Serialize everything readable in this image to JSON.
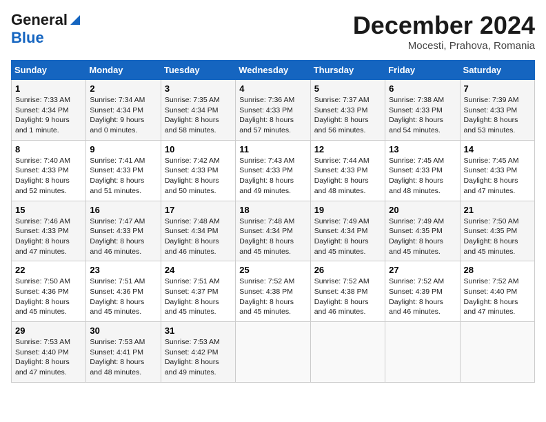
{
  "header": {
    "logo_line1": "General",
    "logo_line2": "Blue",
    "month": "December 2024",
    "location": "Mocesti, Prahova, Romania"
  },
  "weekdays": [
    "Sunday",
    "Monday",
    "Tuesday",
    "Wednesday",
    "Thursday",
    "Friday",
    "Saturday"
  ],
  "weeks": [
    [
      {
        "day": "1",
        "sunrise": "Sunrise: 7:33 AM",
        "sunset": "Sunset: 4:34 PM",
        "daylight": "Daylight: 9 hours and 1 minute."
      },
      {
        "day": "2",
        "sunrise": "Sunrise: 7:34 AM",
        "sunset": "Sunset: 4:34 PM",
        "daylight": "Daylight: 9 hours and 0 minutes."
      },
      {
        "day": "3",
        "sunrise": "Sunrise: 7:35 AM",
        "sunset": "Sunset: 4:34 PM",
        "daylight": "Daylight: 8 hours and 58 minutes."
      },
      {
        "day": "4",
        "sunrise": "Sunrise: 7:36 AM",
        "sunset": "Sunset: 4:33 PM",
        "daylight": "Daylight: 8 hours and 57 minutes."
      },
      {
        "day": "5",
        "sunrise": "Sunrise: 7:37 AM",
        "sunset": "Sunset: 4:33 PM",
        "daylight": "Daylight: 8 hours and 56 minutes."
      },
      {
        "day": "6",
        "sunrise": "Sunrise: 7:38 AM",
        "sunset": "Sunset: 4:33 PM",
        "daylight": "Daylight: 8 hours and 54 minutes."
      },
      {
        "day": "7",
        "sunrise": "Sunrise: 7:39 AM",
        "sunset": "Sunset: 4:33 PM",
        "daylight": "Daylight: 8 hours and 53 minutes."
      }
    ],
    [
      {
        "day": "8",
        "sunrise": "Sunrise: 7:40 AM",
        "sunset": "Sunset: 4:33 PM",
        "daylight": "Daylight: 8 hours and 52 minutes."
      },
      {
        "day": "9",
        "sunrise": "Sunrise: 7:41 AM",
        "sunset": "Sunset: 4:33 PM",
        "daylight": "Daylight: 8 hours and 51 minutes."
      },
      {
        "day": "10",
        "sunrise": "Sunrise: 7:42 AM",
        "sunset": "Sunset: 4:33 PM",
        "daylight": "Daylight: 8 hours and 50 minutes."
      },
      {
        "day": "11",
        "sunrise": "Sunrise: 7:43 AM",
        "sunset": "Sunset: 4:33 PM",
        "daylight": "Daylight: 8 hours and 49 minutes."
      },
      {
        "day": "12",
        "sunrise": "Sunrise: 7:44 AM",
        "sunset": "Sunset: 4:33 PM",
        "daylight": "Daylight: 8 hours and 48 minutes."
      },
      {
        "day": "13",
        "sunrise": "Sunrise: 7:45 AM",
        "sunset": "Sunset: 4:33 PM",
        "daylight": "Daylight: 8 hours and 48 minutes."
      },
      {
        "day": "14",
        "sunrise": "Sunrise: 7:45 AM",
        "sunset": "Sunset: 4:33 PM",
        "daylight": "Daylight: 8 hours and 47 minutes."
      }
    ],
    [
      {
        "day": "15",
        "sunrise": "Sunrise: 7:46 AM",
        "sunset": "Sunset: 4:33 PM",
        "daylight": "Daylight: 8 hours and 47 minutes."
      },
      {
        "day": "16",
        "sunrise": "Sunrise: 7:47 AM",
        "sunset": "Sunset: 4:33 PM",
        "daylight": "Daylight: 8 hours and 46 minutes."
      },
      {
        "day": "17",
        "sunrise": "Sunrise: 7:48 AM",
        "sunset": "Sunset: 4:34 PM",
        "daylight": "Daylight: 8 hours and 46 minutes."
      },
      {
        "day": "18",
        "sunrise": "Sunrise: 7:48 AM",
        "sunset": "Sunset: 4:34 PM",
        "daylight": "Daylight: 8 hours and 45 minutes."
      },
      {
        "day": "19",
        "sunrise": "Sunrise: 7:49 AM",
        "sunset": "Sunset: 4:34 PM",
        "daylight": "Daylight: 8 hours and 45 minutes."
      },
      {
        "day": "20",
        "sunrise": "Sunrise: 7:49 AM",
        "sunset": "Sunset: 4:35 PM",
        "daylight": "Daylight: 8 hours and 45 minutes."
      },
      {
        "day": "21",
        "sunrise": "Sunrise: 7:50 AM",
        "sunset": "Sunset: 4:35 PM",
        "daylight": "Daylight: 8 hours and 45 minutes."
      }
    ],
    [
      {
        "day": "22",
        "sunrise": "Sunrise: 7:50 AM",
        "sunset": "Sunset: 4:36 PM",
        "daylight": "Daylight: 8 hours and 45 minutes."
      },
      {
        "day": "23",
        "sunrise": "Sunrise: 7:51 AM",
        "sunset": "Sunset: 4:36 PM",
        "daylight": "Daylight: 8 hours and 45 minutes."
      },
      {
        "day": "24",
        "sunrise": "Sunrise: 7:51 AM",
        "sunset": "Sunset: 4:37 PM",
        "daylight": "Daylight: 8 hours and 45 minutes."
      },
      {
        "day": "25",
        "sunrise": "Sunrise: 7:52 AM",
        "sunset": "Sunset: 4:38 PM",
        "daylight": "Daylight: 8 hours and 45 minutes."
      },
      {
        "day": "26",
        "sunrise": "Sunrise: 7:52 AM",
        "sunset": "Sunset: 4:38 PM",
        "daylight": "Daylight: 8 hours and 46 minutes."
      },
      {
        "day": "27",
        "sunrise": "Sunrise: 7:52 AM",
        "sunset": "Sunset: 4:39 PM",
        "daylight": "Daylight: 8 hours and 46 minutes."
      },
      {
        "day": "28",
        "sunrise": "Sunrise: 7:52 AM",
        "sunset": "Sunset: 4:40 PM",
        "daylight": "Daylight: 8 hours and 47 minutes."
      }
    ],
    [
      {
        "day": "29",
        "sunrise": "Sunrise: 7:53 AM",
        "sunset": "Sunset: 4:40 PM",
        "daylight": "Daylight: 8 hours and 47 minutes."
      },
      {
        "day": "30",
        "sunrise": "Sunrise: 7:53 AM",
        "sunset": "Sunset: 4:41 PM",
        "daylight": "Daylight: 8 hours and 48 minutes."
      },
      {
        "day": "31",
        "sunrise": "Sunrise: 7:53 AM",
        "sunset": "Sunset: 4:42 PM",
        "daylight": "Daylight: 8 hours and 49 minutes."
      },
      null,
      null,
      null,
      null
    ]
  ]
}
